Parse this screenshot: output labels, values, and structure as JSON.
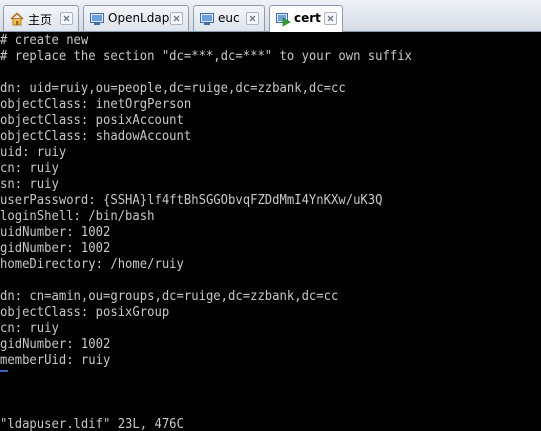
{
  "tabs": [
    {
      "label": "主页",
      "icon": "home-icon",
      "active": false
    },
    {
      "label": "OpenLdap",
      "icon": "vm-icon",
      "active": false
    },
    {
      "label": "euc",
      "icon": "vm-icon",
      "active": false
    },
    {
      "label": "cert",
      "icon": "vm-running-icon",
      "active": true
    }
  ],
  "console": {
    "lines": [
      "# create new",
      "# replace the section \"dc=***,dc=***\" to your own suffix",
      "",
      "dn: uid=ruiy,ou=people,dc=ruige,dc=zzbank,dc=cc",
      "objectClass: inetOrgPerson",
      "objectClass: posixAccount",
      "objectClass: shadowAccount",
      "uid: ruiy",
      "cn: ruiy",
      "sn: ruiy",
      "userPassword: {SSHA}lf4ftBhSGGObvqFZDdMmI4YnKXw/uK3Q",
      "loginShell: /bin/bash",
      "uidNumber: 1002",
      "gidNumber: 1002",
      "homeDirectory: /home/ruiy",
      "",
      "dn: cn=amin,ou=groups,dc=ruige,dc=zzbank,dc=cc",
      "objectClass: posixGroup",
      "cn: ruiy",
      "gidNumber: 1002",
      "memberUid: ruiy"
    ],
    "status_line": "\"ldapuser.ldif\" 23L, 476C"
  }
}
